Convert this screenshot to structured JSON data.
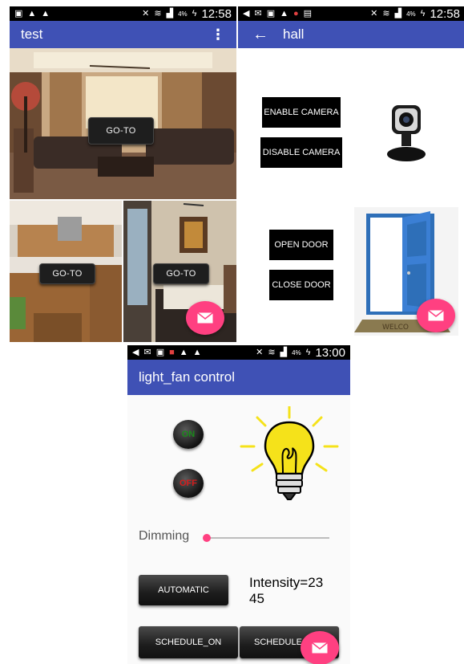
{
  "colors": {
    "primary": "#3f51b5",
    "accent": "#ff4081",
    "statusbar": "#000000",
    "button_dark": "#1e1e1e",
    "on_text": "#1a8a1a",
    "off_text": "#d61c1c",
    "bulb_yellow": "#f5e21a"
  },
  "screen1": {
    "status": {
      "left_icons": [
        "gallery-icon",
        "warning-icon",
        "warning-icon"
      ],
      "right_icons": [
        "mute-icon",
        "wifi-icon",
        "signal-icon"
      ],
      "battery": "4%",
      "time": "12:58"
    },
    "appbar": {
      "title": "test",
      "menu_icon": "overflow-menu-icon"
    },
    "rooms": [
      {
        "name": "living-room",
        "button": "GO-TO"
      },
      {
        "name": "kitchen",
        "button": "GO-TO"
      },
      {
        "name": "bedroom",
        "button": "GO-TO"
      }
    ],
    "fab_icon": "mail-icon"
  },
  "screen2": {
    "status": {
      "left_icons": [
        "back-icon",
        "mail-icon",
        "gallery-icon",
        "warning-icon",
        "chrome-icon",
        "photo-icon"
      ],
      "right_icons": [
        "mute-icon",
        "wifi-icon",
        "signal-icon"
      ],
      "battery": "4%",
      "time": "12:58"
    },
    "appbar": {
      "title": "hall",
      "back_icon": "arrow-left-icon"
    },
    "buttons": {
      "enable_camera": "ENABLE CAMERA",
      "disable_camera": "DISABLE CAMERA",
      "open_door": "OPEN DOOR",
      "close_door": "CLOSE DOOR"
    },
    "images": {
      "camera": "webcam-image",
      "door": "open-door-image",
      "mat_text": "WELCO"
    },
    "fab_icon": "mail-icon"
  },
  "screen3": {
    "status": {
      "left_icons": [
        "back-icon",
        "mail-icon",
        "gallery-icon",
        "red-app-icon",
        "warning-icon",
        "warning-icon"
      ],
      "right_icons": [
        "mute-icon",
        "wifi-icon",
        "signal-icon"
      ],
      "battery": "4%",
      "time": "13:00"
    },
    "appbar": {
      "title": "light_fan control"
    },
    "on_label": "ON",
    "off_label": "OFF",
    "dimming_label": "Dimming",
    "dimming_value": 0,
    "automatic_label": "AUTOMATIC",
    "intensity_text": "Intensity=23\n45",
    "schedule_on_label": "SCHEDULE_ON",
    "schedule_off_label": "SCHEDULE",
    "fab_icon": "mail-icon"
  }
}
